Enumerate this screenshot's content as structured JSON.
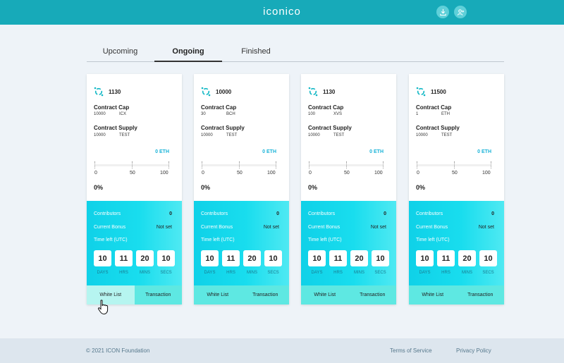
{
  "header": {
    "logo_text": "iconico",
    "brand_color": "#17aab9"
  },
  "tabs": [
    {
      "label": "Upcoming",
      "active": false
    },
    {
      "label": "Ongoing",
      "active": true
    },
    {
      "label": "Finished",
      "active": false
    }
  ],
  "cards": [
    {
      "number": "1130",
      "contract_cap_label": "Contract Cap",
      "cap_value": "10000",
      "cap_unit": "ICX",
      "contract_supply_label": "Contract Supply",
      "supply_value": "10000",
      "supply_unit": "TEST",
      "raised": "0 ETH",
      "scale": [
        "0",
        "50",
        "100"
      ],
      "percent": "0%",
      "contributors_label": "Contributors",
      "contributors": "0",
      "bonus_label": "Current Bonus",
      "bonus": "Not set",
      "time_label": "Time left (UTC)",
      "countdown": [
        {
          "value": "10",
          "unit": "DAYS"
        },
        {
          "value": "11",
          "unit": "HRS"
        },
        {
          "value": "20",
          "unit": "MINS"
        },
        {
          "value": "10",
          "unit": "SECS"
        }
      ],
      "whitelist_label": "White List",
      "transaction_label": "Transaction"
    },
    {
      "number": "10000",
      "contract_cap_label": "Contract Cap",
      "cap_value": "30",
      "cap_unit": "BCH",
      "contract_supply_label": "Contract Supply",
      "supply_value": "10000",
      "supply_unit": "TEST",
      "raised": "0 ETH",
      "scale": [
        "0",
        "50",
        "100"
      ],
      "percent": "0%",
      "contributors_label": "Contributors",
      "contributors": "0",
      "bonus_label": "Current Bonus",
      "bonus": "Not set",
      "time_label": "Time left (UTC)",
      "countdown": [
        {
          "value": "10",
          "unit": "DAYS"
        },
        {
          "value": "11",
          "unit": "HRS"
        },
        {
          "value": "20",
          "unit": "MINS"
        },
        {
          "value": "10",
          "unit": "SECS"
        }
      ],
      "whitelist_label": "White List",
      "transaction_label": "Transaction"
    },
    {
      "number": "1130",
      "contract_cap_label": "Contract Cap",
      "cap_value": "100",
      "cap_unit": "XVS",
      "contract_supply_label": "Contract Supply",
      "supply_value": "10000",
      "supply_unit": "TEST",
      "raised": "0 ETH",
      "scale": [
        "0",
        "50",
        "100"
      ],
      "percent": "0%",
      "contributors_label": "Contributors",
      "contributors": "0",
      "bonus_label": "Current Bonus",
      "bonus": "Not set",
      "time_label": "Time left (UTC)",
      "countdown": [
        {
          "value": "10",
          "unit": "DAYS"
        },
        {
          "value": "11",
          "unit": "HRS"
        },
        {
          "value": "20",
          "unit": "MINS"
        },
        {
          "value": "10",
          "unit": "SECS"
        }
      ],
      "whitelist_label": "White List",
      "transaction_label": "Transaction"
    },
    {
      "number": "11500",
      "contract_cap_label": "Contract Cap",
      "cap_value": "1",
      "cap_unit": "ETH",
      "contract_supply_label": "Contract Supply",
      "supply_value": "10000",
      "supply_unit": "TEST",
      "raised": "0 ETH",
      "scale": [
        "0",
        "50",
        "100"
      ],
      "percent": "0%",
      "contributors_label": "Contributors",
      "contributors": "0",
      "bonus_label": "Current Bonus",
      "bonus": "Not set",
      "time_label": "Time left (UTC)",
      "countdown": [
        {
          "value": "10",
          "unit": "DAYS"
        },
        {
          "value": "11",
          "unit": "HRS"
        },
        {
          "value": "20",
          "unit": "MINS"
        },
        {
          "value": "10",
          "unit": "SECS"
        }
      ],
      "whitelist_label": "White List",
      "transaction_label": "Transaction"
    }
  ],
  "footer": {
    "copyright": "© 2021 ICON Foundation",
    "terms": "Terms of Service",
    "privacy": "Privacy Policy"
  }
}
